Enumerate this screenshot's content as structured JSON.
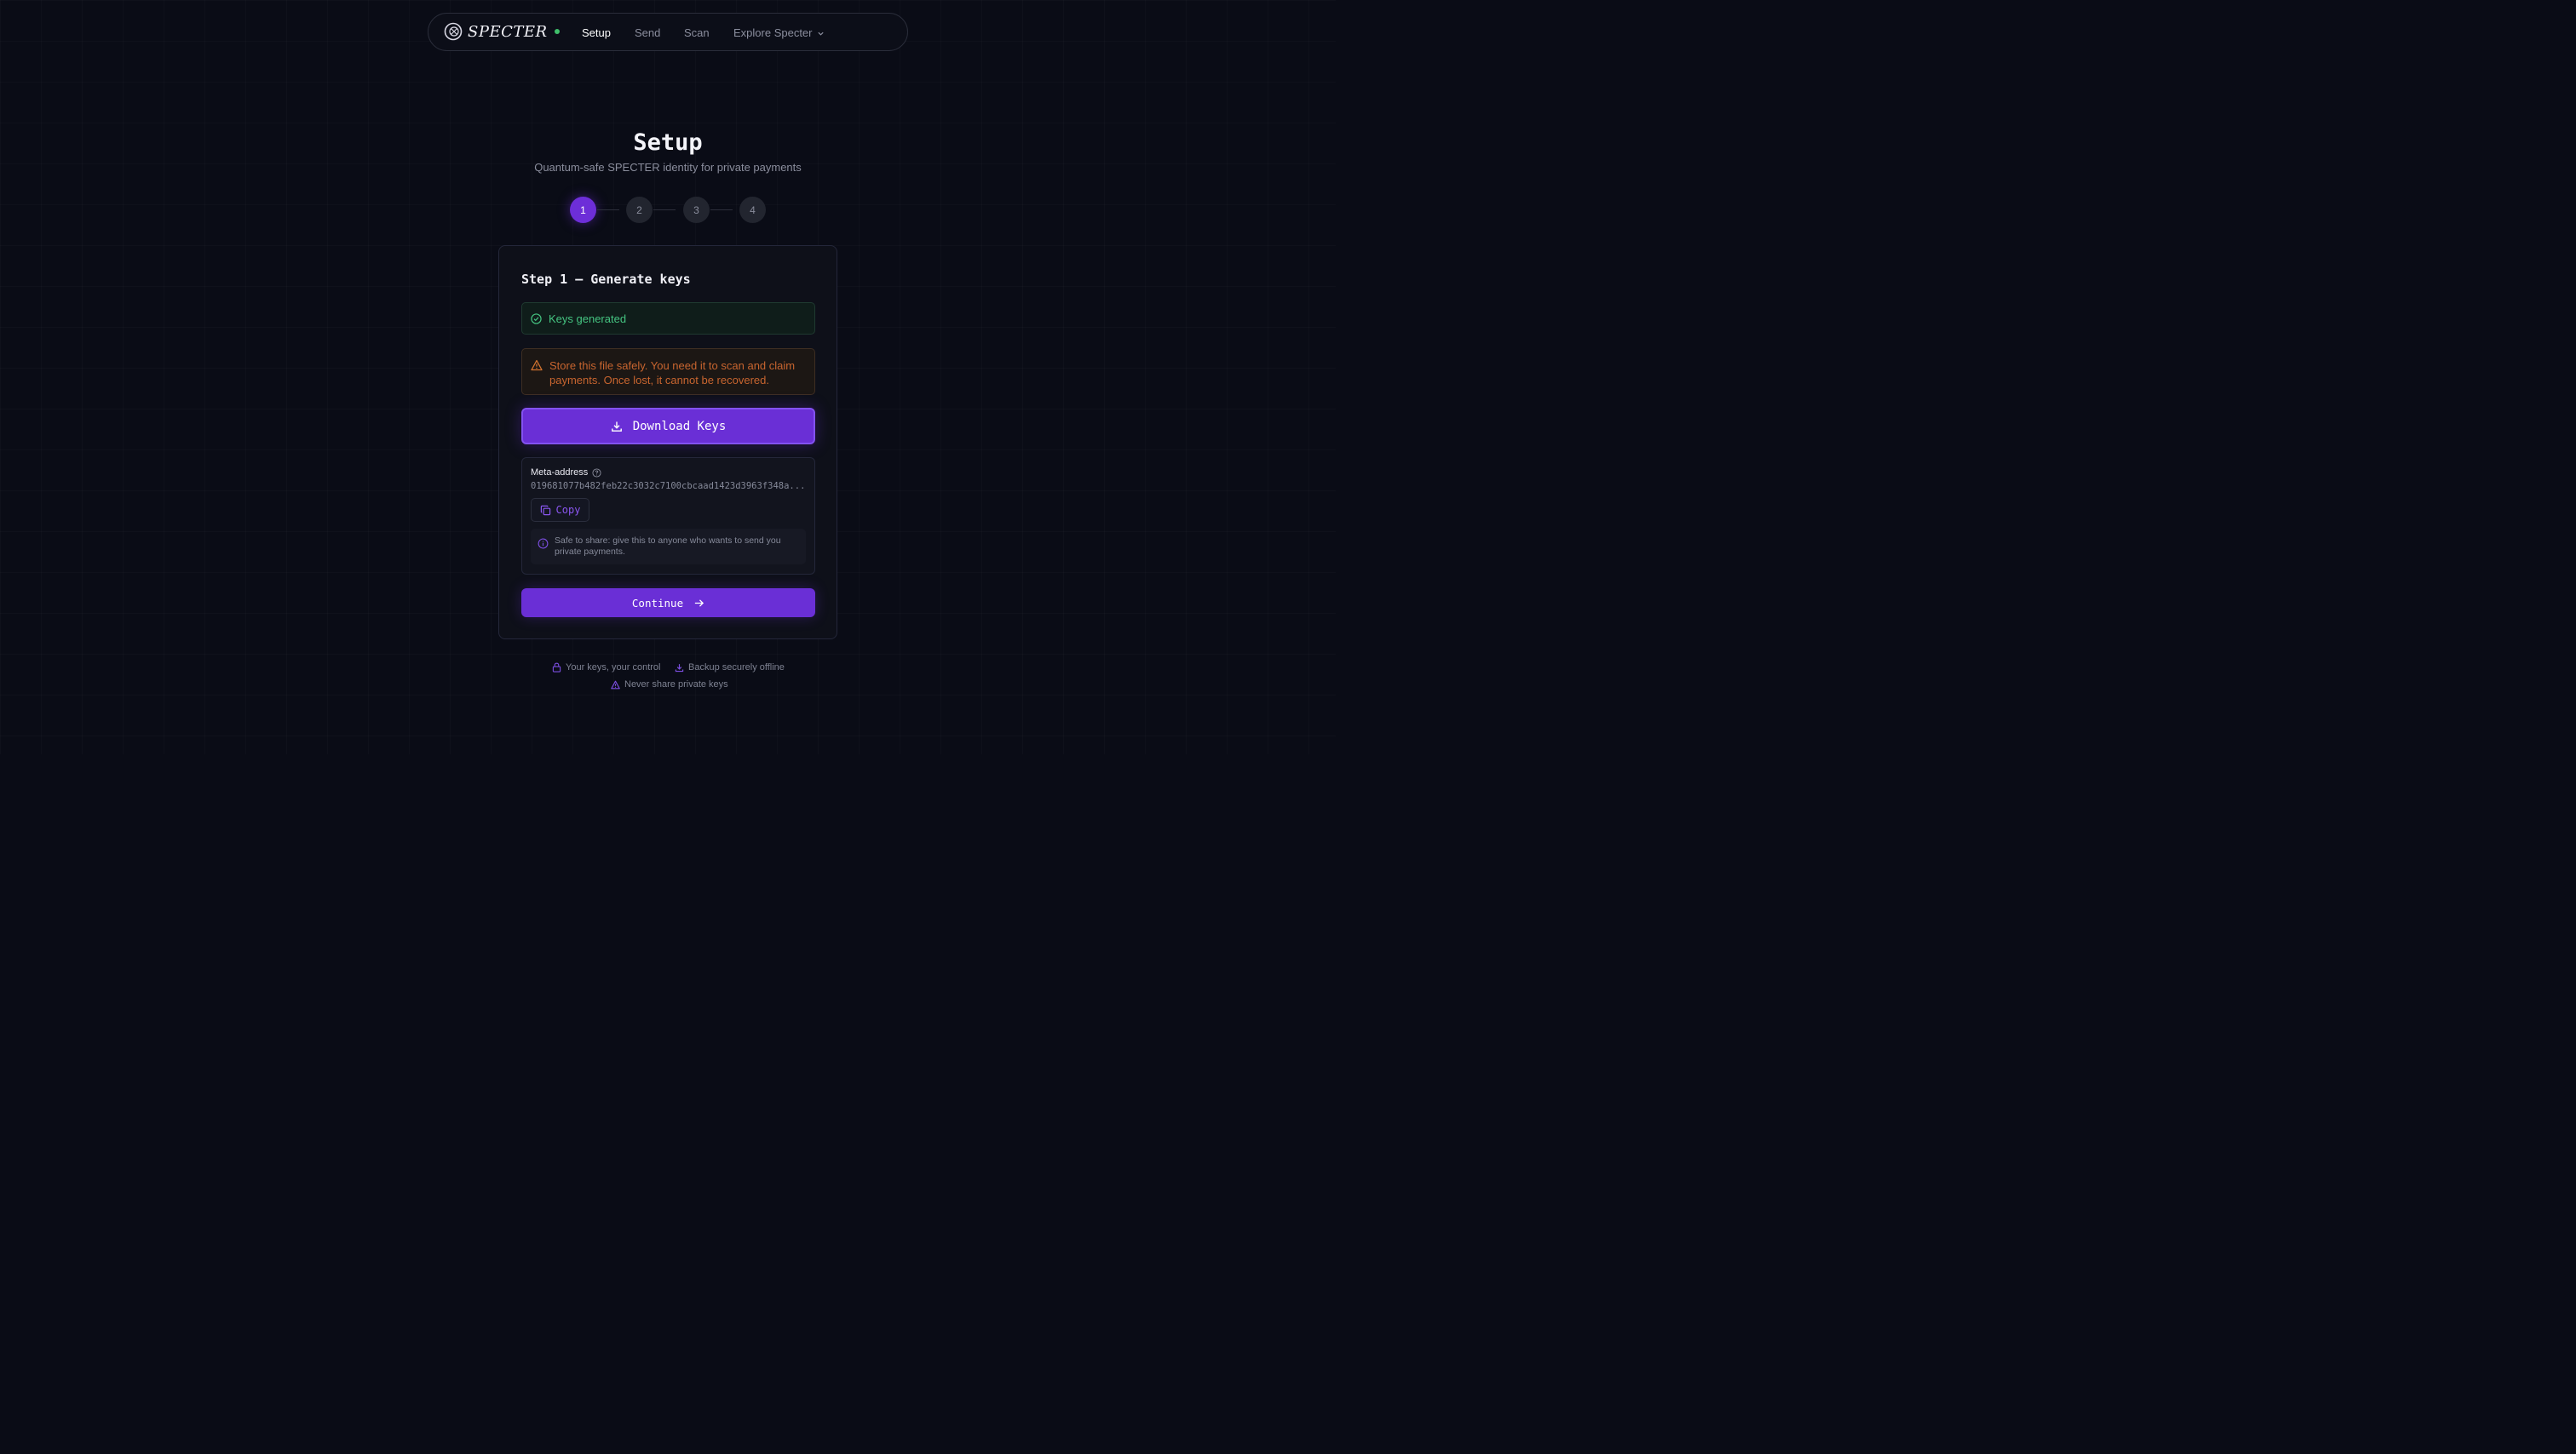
{
  "nav": {
    "brand": "SPECTER",
    "links": [
      {
        "label": "Setup",
        "active": true
      },
      {
        "label": "Send",
        "active": false
      },
      {
        "label": "Scan",
        "active": false
      },
      {
        "label": "Explore Specter",
        "active": false,
        "has_dropdown": true
      }
    ]
  },
  "header": {
    "title": "Setup",
    "subtitle": "Quantum-safe SPECTER identity for private payments"
  },
  "stepper": {
    "steps": [
      "1",
      "2",
      "3",
      "4"
    ],
    "current": 1
  },
  "card": {
    "title": "Step 1 — Generate keys",
    "success_message": "Keys generated",
    "warning_line1": "Store this file safely. You need it to scan and claim",
    "warning_line2": "payments. Once lost, it cannot be recovered.",
    "download_label": "Download Keys",
    "meta": {
      "label": "Meta-address",
      "address": "019681077b482feb22c3032c7100cbcaad1423d3963f348a...",
      "copy_label": "Copy",
      "info_line1": "Safe to share: give this to anyone who wants to send you",
      "info_line2": "private payments."
    },
    "continue_label": "Continue"
  },
  "footer": {
    "items": [
      {
        "icon": "lock-icon",
        "label": "Your keys, your control"
      },
      {
        "icon": "download-icon",
        "label": "Backup securely offline"
      },
      {
        "icon": "warning-icon",
        "label": "Never share private keys"
      }
    ]
  },
  "colors": {
    "accent": "#6a2fd6",
    "success": "#45c481",
    "warning": "#c8652f",
    "background": "#0a0c16"
  }
}
